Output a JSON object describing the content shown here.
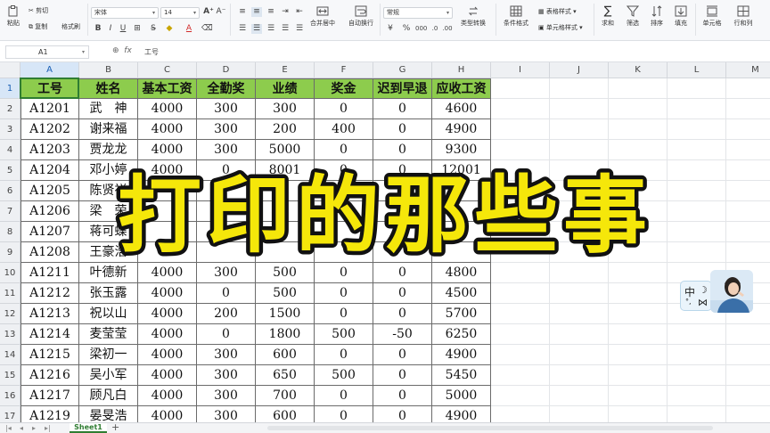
{
  "ribbon": {
    "paste": "粘贴",
    "cut": "剪切",
    "copy": "复制",
    "format_painter": "格式刷",
    "font_name": "宋体",
    "font_size": "14",
    "merge_center": "合并居中",
    "wrap_text": "自动换行",
    "number_format": "常规",
    "type_convert": "类型转换",
    "conditional_format": "条件格式",
    "table_style": "表格样式",
    "cell_style": "单元格样式",
    "sum": "求和",
    "filter": "筛选",
    "sort": "排序",
    "fill": "填充",
    "cell": "单元格",
    "row_col": "行和列",
    "currency_symbol": "¥",
    "percent_symbol": "%"
  },
  "formula_bar": {
    "name_box": "A1",
    "formula": "工号"
  },
  "columns": [
    "A",
    "B",
    "C",
    "D",
    "E",
    "F",
    "G",
    "H",
    "I",
    "J",
    "K",
    "L",
    "M"
  ],
  "row_numbers": [
    "1",
    "2",
    "3",
    "4",
    "5",
    "6",
    "7",
    "8",
    "9",
    "10",
    "11",
    "12",
    "13",
    "14",
    "15",
    "16",
    "17"
  ],
  "table": {
    "headers": [
      "工号",
      "姓名",
      "基本工资",
      "全勤奖",
      "业绩",
      "奖金",
      "迟到早退",
      "应收工资"
    ],
    "rows": [
      [
        "A1201",
        "武　神",
        "4000",
        "300",
        "300",
        "0",
        "0",
        "4600"
      ],
      [
        "A1202",
        "谢来福",
        "4000",
        "300",
        "200",
        "400",
        "0",
        "4900"
      ],
      [
        "A1203",
        "贾龙龙",
        "4000",
        "300",
        "5000",
        "0",
        "0",
        "9300"
      ],
      [
        "A1204",
        "邓小婷",
        "4000",
        "0",
        "8001",
        "0",
        "0",
        "12001"
      ],
      [
        "A1205",
        "陈贤祥",
        "",
        "",
        "",
        "",
        "",
        ""
      ],
      [
        "A1206",
        "梁　荣",
        "",
        "3",
        "",
        "",
        "",
        ""
      ],
      [
        "A1207",
        "蒋可蝶",
        "",
        "3",
        "",
        "",
        "",
        ""
      ],
      [
        "A1208",
        "王豪浩",
        "",
        "",
        "",
        "",
        "",
        ""
      ],
      [
        "A1211",
        "叶德新",
        "4000",
        "300",
        "500",
        "0",
        "0",
        "4800"
      ],
      [
        "A1212",
        "张玉露",
        "4000",
        "0",
        "500",
        "0",
        "0",
        "4500"
      ],
      [
        "A1213",
        "祝以山",
        "4000",
        "200",
        "1500",
        "0",
        "0",
        "5700"
      ],
      [
        "A1214",
        "麦莹莹",
        "4000",
        "0",
        "1800",
        "500",
        "-50",
        "6250"
      ],
      [
        "A1215",
        "梁初一",
        "4000",
        "300",
        "600",
        "0",
        "0",
        "4900"
      ],
      [
        "A1216",
        "吴小军",
        "4000",
        "300",
        "650",
        "500",
        "0",
        "5450"
      ],
      [
        "A1217",
        "顾凡白",
        "4000",
        "300",
        "700",
        "0",
        "0",
        "5000"
      ],
      [
        "A1219",
        "晏旻浩",
        "4000",
        "300",
        "600",
        "0",
        "0",
        "4900"
      ]
    ]
  },
  "overlay_title": "打印的那些事",
  "widget": {
    "label": "中"
  },
  "sheet_tab": "Sheet1",
  "colors": {
    "header_fill": "#8dcc4d",
    "title_fill": "#f5e70a",
    "title_stroke": "#111111",
    "accent": "#2f7d32"
  }
}
